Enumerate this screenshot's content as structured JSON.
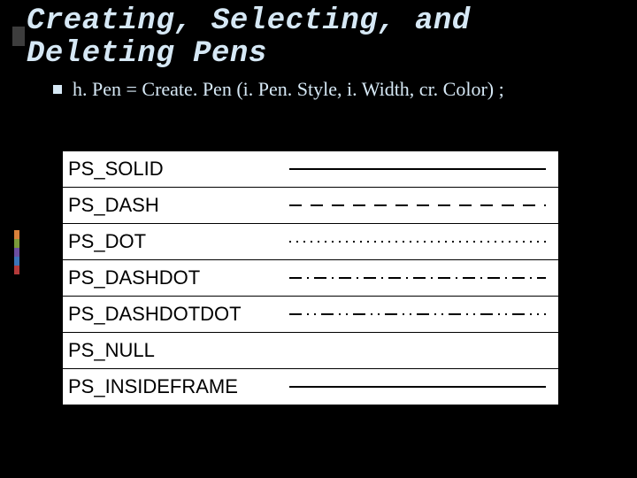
{
  "title": "Creating, Selecting, and Deleting Pens",
  "bullet_text": "h. Pen = Create. Pen (i. Pen. Style, i. Width, cr. Color) ;",
  "pen_styles": [
    {
      "name": "PS_SOLID",
      "pattern": "solid"
    },
    {
      "name": "PS_DASH",
      "pattern": "dash"
    },
    {
      "name": "PS_DOT",
      "pattern": "dot"
    },
    {
      "name": "PS_DASHDOT",
      "pattern": "dashdot"
    },
    {
      "name": "PS_DASHDOTDOT",
      "pattern": "dashdotdot"
    },
    {
      "name": "PS_NULL",
      "pattern": "null"
    },
    {
      "name": "PS_INSIDEFRAME",
      "pattern": "solid"
    }
  ],
  "accent_colors": [
    "#d8803a",
    "#7a9a3a",
    "#6b4ea0",
    "#3a74b8",
    "#b43a3a"
  ]
}
